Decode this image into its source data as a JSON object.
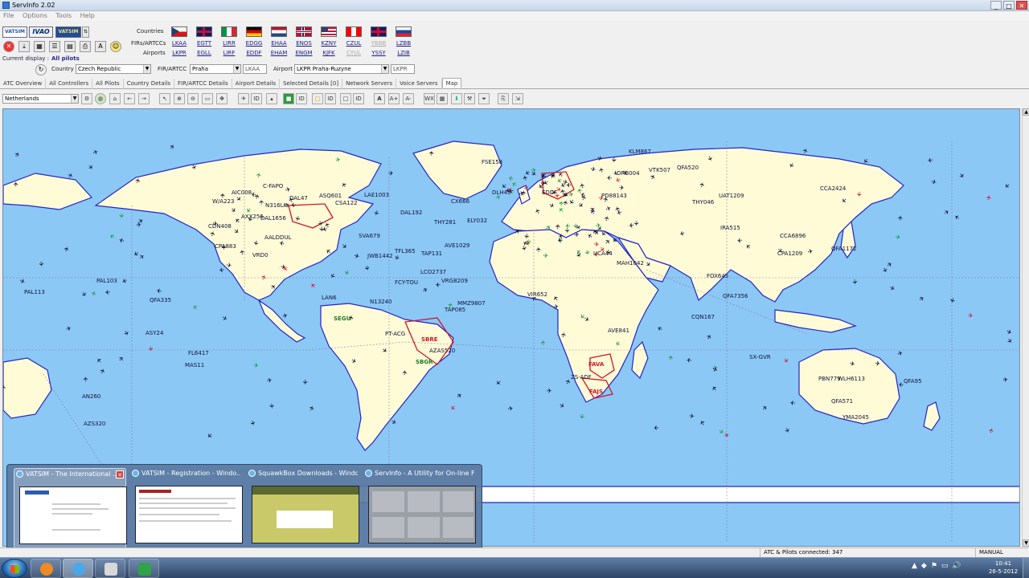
{
  "window": {
    "title": "ServInfo 2.02"
  },
  "menu": [
    "File",
    "Options",
    "Tools",
    "Help"
  ],
  "networks": [
    "VATSIM",
    "IVAO",
    "VATSIM"
  ],
  "header_labels": {
    "countries": "Countries",
    "firs": "FIRs/ARTCCs",
    "airports": "Airports"
  },
  "flags": [
    {
      "name": "czech",
      "fir": "LKAA",
      "airport": "LKPR",
      "colors": [
        "#ffffff",
        "#d7141a",
        "#11457e"
      ]
    },
    {
      "name": "uk",
      "fir": "EGTT",
      "airport": "EGLL",
      "colors": [
        "#012169",
        "#ffffff",
        "#c8102e"
      ]
    },
    {
      "name": "italy",
      "fir": "LIRR",
      "airport": "LIRF",
      "colors": [
        "#009246",
        "#ffffff",
        "#ce2b37"
      ]
    },
    {
      "name": "germany",
      "fir": "EDGG",
      "airport": "EDDF",
      "colors": [
        "#000000",
        "#dd0000",
        "#ffce00"
      ]
    },
    {
      "name": "netherlands",
      "fir": "EHAA",
      "airport": "EHAM",
      "colors": [
        "#ae1c28",
        "#ffffff",
        "#21468b"
      ]
    },
    {
      "name": "norway",
      "fir": "ENOS",
      "airport": "ENGM",
      "colors": [
        "#ba0c2f",
        "#ffffff",
        "#00205b"
      ]
    },
    {
      "name": "usa",
      "fir": "KZNY",
      "airport": "KJFK",
      "colors": [
        "#b22234",
        "#ffffff",
        "#3c3b6e"
      ]
    },
    {
      "name": "canada",
      "fir": "CZUL",
      "airport": "CYUL",
      "colors": [
        "#ff0000",
        "#ffffff",
        "#ff0000"
      ]
    },
    {
      "name": "australia",
      "fir": "YBBB",
      "airport": "YSSY",
      "colors": [
        "#012169",
        "#ffffff",
        "#e4002b"
      ]
    },
    {
      "name": "slovenia",
      "fir": "LZBB",
      "airport": "LZIB",
      "colors": [
        "#ffffff",
        "#0b4ea2",
        "#ee1c25"
      ]
    }
  ],
  "current_display": {
    "label": "Current display :",
    "value": "All pilots"
  },
  "filters": {
    "country_label": "Country",
    "country_value": "Czech Republic",
    "fir_label": "FIR/ARTCC",
    "fir_value": "Praha",
    "fir_code": "LKAA",
    "airport_label": "Airport",
    "airport_value": "LKPR Praha-Ruzyne",
    "airport_code": "LKPR"
  },
  "tabs": [
    "ATC Overview",
    "All Controllers",
    "All Pilots",
    "Country Details",
    "FIR/ARTCC Details",
    "Airport Details",
    "Selected Details [0]",
    "Network Servers",
    "Voice Servers",
    "Map"
  ],
  "active_tab": "Map",
  "map_toolbar": {
    "region": "Netherlands"
  },
  "map_labels": [
    "C-FAPO",
    "ASQ601",
    "LAE1003",
    "CSA122",
    "AIC008",
    "DAL47",
    "N316LK",
    "W/A223",
    "CDN408",
    "DAL1656",
    "AXX256",
    "CPA883",
    "VRD0",
    "AALDDUL",
    "SVA679",
    "TFL365",
    "TAP131",
    "AVE1029",
    "ELY032",
    "CX666",
    "THY281",
    "DAL192",
    "JWB1442",
    "FCY-TOU",
    "LCO2737",
    "VRG8209",
    "N13240",
    "LAN6",
    "SEGU",
    "SBRE",
    "TAP085",
    "MMZ9807",
    "PT-ACG",
    "AZAS520",
    "SBGR",
    "FAVA",
    "FAJS",
    "ZS-ADF",
    "FSE158",
    "DLH45",
    "PD88143",
    "VTK507",
    "QFA520",
    "KLM867",
    "UAT1209",
    "CCA2424",
    "THY046",
    "IRA515",
    "CCA6896",
    "CPA1209",
    "QFA1172",
    "PAL103",
    "PAL113",
    "FOX645",
    "QFA335",
    "ASY24",
    "MAS11",
    "FL6417",
    "VIR652",
    "AVE841",
    "UCA44",
    "QFA7356",
    "CQN167",
    "SX-GVR",
    "PBN779",
    "WLH6113",
    "QFA571",
    "YMA2045",
    "AZS320",
    "AN260",
    "QFA95",
    "EDDF",
    "MAH1042",
    "ORB004"
  ],
  "preview_windows": [
    {
      "title": "VATSIM - The International ...",
      "thumb": "white"
    },
    {
      "title": "VATSIM - Registration - Windo...",
      "thumb": "white"
    },
    {
      "title": "SquawkBox Downloads - Windo...",
      "thumb": "olive"
    },
    {
      "title": "ServInfo - A Utility for On-line Fl...",
      "thumb": "gray"
    }
  ],
  "status": {
    "connected": "ATC & Pilots connected: 347",
    "mode": "MANUAL"
  },
  "clock": {
    "time": "10:41",
    "date": "26-5-2012"
  },
  "colors": {
    "ocean": "#8cc8f5",
    "land": "#fffbd6",
    "coast": "#2424c8",
    "aircraft": "#10103a",
    "fir_red": "#d2142a",
    "taskbar": "#2d4567"
  }
}
